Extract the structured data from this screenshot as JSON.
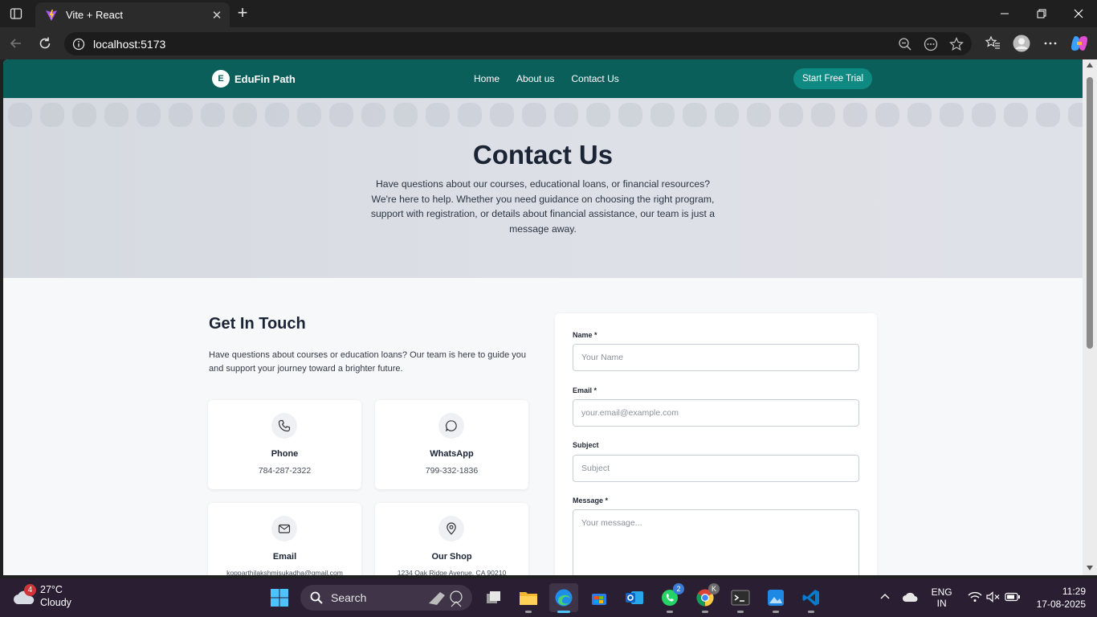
{
  "browser": {
    "tab_title": "Vite + React",
    "url": "localhost:5173"
  },
  "site": {
    "brand_initial": "E",
    "brand_name": "EduFin Path",
    "nav": [
      "Home",
      "About us",
      "Contact Us"
    ],
    "cta": "Start Free Trial"
  },
  "hero": {
    "title": "Contact Us",
    "text": "Have questions about our courses, educational loans, or financial resources? We're here to help. Whether you need guidance on choosing the right program, support with registration, or details about financial assistance, our team is just a message away."
  },
  "touch": {
    "title": "Get In Touch",
    "text": "Have questions about courses or education loans? Our team is here to guide you and support your journey toward a brighter future.",
    "cards": [
      {
        "label": "Phone",
        "value": "784-287-2322",
        "icon": "phone-icon"
      },
      {
        "label": "WhatsApp",
        "value": "799-332-1836",
        "icon": "chat-icon"
      },
      {
        "label": "Email",
        "value": "kopparthilakshmisukadha@gmail.com",
        "icon": "mail-icon"
      },
      {
        "label": "Our Shop",
        "value": "1234 Oak Ridge Avenue, CA 90210",
        "icon": "map-pin-icon"
      }
    ]
  },
  "form": {
    "name_label": "Name *",
    "name_placeholder": "Your Name",
    "email_label": "Email *",
    "email_placeholder": "your.email@example.com",
    "subject_label": "Subject",
    "subject_placeholder": "Subject",
    "message_label": "Message *",
    "message_placeholder": "Your message..."
  },
  "taskbar": {
    "weather_badge": "4",
    "temperature": "27°C",
    "condition": "Cloudy",
    "search_placeholder": "Search",
    "whatsapp_badge": "2",
    "chrome_badge": "K",
    "lang_top": "ENG",
    "lang_bottom": "IN",
    "time": "11:29",
    "date": "17-08-2025"
  },
  "colors": {
    "nav_bg": "#0b5f5b",
    "cta_bg": "#0f8a82",
    "hero_bg": "#d9dde3",
    "heading": "#1b2434"
  }
}
